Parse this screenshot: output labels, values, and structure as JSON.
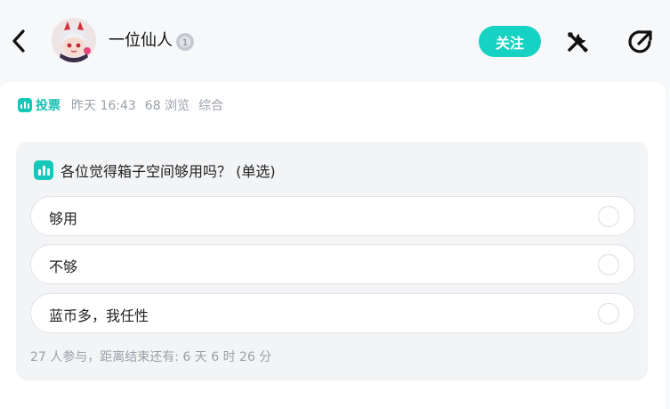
{
  "header": {
    "username": "一位仙人",
    "level_badge": "1",
    "follow_label": "关注"
  },
  "post": {
    "tag_label": "投票",
    "time": "昨天 16:43",
    "views": "68 浏览",
    "category": "综合"
  },
  "poll": {
    "question": "各位觉得箱子空间够用吗？ (单选)",
    "options": [
      {
        "label": "够用"
      },
      {
        "label": "不够"
      },
      {
        "label": "蓝币多，我任性"
      }
    ],
    "footer": "27 人参与，距离结束还有: 6 天 6 时 26 分"
  },
  "colors": {
    "accent": "#16d2c3",
    "muted_text": "#9aa0a8"
  },
  "icons": {
    "back": "chevron-left-icon",
    "tools": "tools-icon",
    "share": "share-icon",
    "vote": "poll-chart-icon"
  }
}
